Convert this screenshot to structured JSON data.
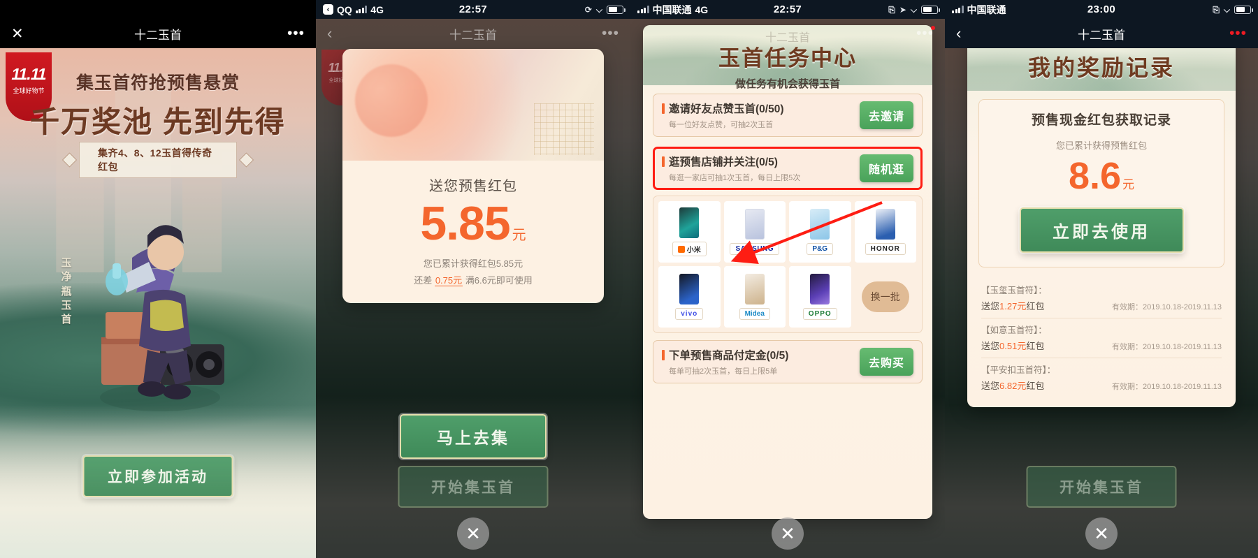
{
  "panel1": {
    "nav": {
      "close_icon": "close-icon",
      "title": "十二玉首",
      "more_icon": "more-dots-icon"
    },
    "badge": {
      "big": "11.11",
      "small": "全球好物节"
    },
    "headline1": "集玉首符抢预售悬赏",
    "headline2": "千万奖池  先到先得",
    "ribbon": "集齐4、8、12玉首得传奇红包",
    "vertical_text": "玉净瓶玉首",
    "cta": "立即参加活动"
  },
  "panel2": {
    "status": {
      "app": "QQ",
      "network": "4G",
      "time": "22:57",
      "signal_icon": "signal-bars-icon",
      "battery_icon": "battery-icon"
    },
    "nav": {
      "back_icon": "chevron-left-icon",
      "title": "十二玉首",
      "more_icon": "more-dots-icon"
    },
    "card": {
      "title": "送您预售红包",
      "amount": "5.85",
      "unit": "元",
      "sub1": "您已累计获得红包5.85元",
      "sub2_pre": "还差 ",
      "sub2_hl": "0.75元",
      "sub2_post": " 满6.6元即可使用"
    },
    "cta": "马上去集",
    "bg": {
      "title": "十二玉首",
      "cta": "开始集玉首",
      "badge_big": "11.11",
      "badge_small": "全球好物节"
    },
    "close_icon": "close-circle-icon"
  },
  "panel3": {
    "status": {
      "carrier": "中国联通",
      "network": "4G",
      "time": "22:57",
      "signal_icon": "signal-bars-icon",
      "rotation_lock_icon": "rotation-lock-icon",
      "location_icon": "location-arrow-icon",
      "headphones_icon": "headphones-icon",
      "battery_icon": "battery-icon"
    },
    "nav": {
      "more_icon": "more-dots-icon",
      "notification_dot": "red-dot"
    },
    "card": {
      "ghost_title": "十二玉首",
      "heading": "玉首任务中心",
      "subheading": "做任务有机会获得玉首",
      "tasks": [
        {
          "title": "邀请好友点赞玉首(0/50)",
          "desc": "每一位好友点赞，可抽2次玉首",
          "button": "去邀请",
          "highlighted": false
        },
        {
          "title": "逛预售店铺并关注(0/5)",
          "desc": "每逛一家店可抽1次玉首，每日上限5次",
          "button": "随机逛",
          "highlighted": true
        },
        {
          "title": "下单预售商品付定金(0/5)",
          "desc": "每单可抽2次玉首，每日上限5单",
          "button": "去购买",
          "highlighted": false
        }
      ],
      "brands": [
        {
          "name": "小米",
          "style": "xiaomi",
          "phone": "a"
        },
        {
          "name": "SAMSUNG",
          "style": "samsung",
          "phone": "b"
        },
        {
          "name": "P&G",
          "style": "pg",
          "phone": "c"
        },
        {
          "name": "HONOR",
          "style": "honor",
          "phone": "d"
        },
        {
          "name": "vivo",
          "style": "vivo",
          "phone": "e"
        },
        {
          "name": "Midea",
          "style": "midea",
          "phone": "f"
        },
        {
          "name": "OPPO",
          "style": "oppo",
          "phone": "g"
        }
      ],
      "refresh_label": "换一批"
    },
    "annotation": {
      "type": "red-arrow",
      "color": "#fe1d13"
    },
    "close_icon": "close-circle-icon"
  },
  "panel4": {
    "status": {
      "carrier": "中国联通",
      "network": "",
      "time": "23:00",
      "signal_icon": "signal-bars-icon",
      "rotation_lock_icon": "rotation-lock-icon",
      "headphones_icon": "headphones-icon",
      "battery_icon": "battery-icon"
    },
    "nav": {
      "back_icon": "chevron-left-icon",
      "title": "十二玉首",
      "more_icon": "more-dots-icon"
    },
    "card": {
      "heading": "我的奖励记录",
      "box_title": "预售现金红包获取记录",
      "box_sub": "您已累计获得预售红包",
      "amount": "8.6",
      "unit": "元",
      "cta": "立即去使用",
      "records": [
        {
          "name": "【玉玺玉首符】：",
          "give_pre": "送您",
          "give_amt": "1.27元",
          "give_post": "红包",
          "valid": "有效期：2019.10.18-2019.11.13"
        },
        {
          "name": "【如意玉首符】：",
          "give_pre": "送您",
          "give_amt": "0.51元",
          "give_post": "红包",
          "valid": "有效期：2019.10.18-2019.11.13"
        },
        {
          "name": "【平安扣玉首符】：",
          "give_pre": "送您",
          "give_amt": "6.82元",
          "give_post": "红包",
          "valid": "有效期：2019.10.18-2019.11.13"
        }
      ]
    },
    "bg": {
      "cta": "开始集玉首"
    },
    "close_icon": "close-circle-icon"
  }
}
